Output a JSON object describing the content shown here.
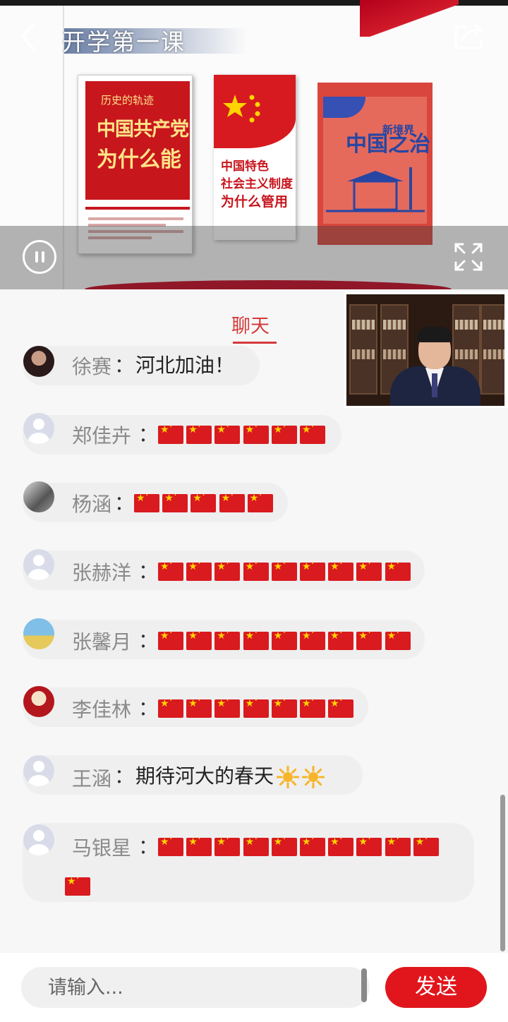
{
  "header": {
    "title": "开学第一课",
    "back_icon": "chevron-left-icon",
    "share_icon": "share-icon"
  },
  "player": {
    "pause_icon": "pause-icon",
    "fullscreen_icon": "fullscreen-icon",
    "books": [
      {
        "line1": "历史的轨迹",
        "line2": "中国共产党",
        "line3": "为什么能"
      },
      {
        "line1": "中国特色",
        "line2": "社会主义制度",
        "line3": "为什么管用"
      },
      {
        "line1": "新境界",
        "line2": "中国之治"
      }
    ]
  },
  "chat": {
    "tab_label": "聊天",
    "colon": "：",
    "messages": [
      {
        "name": "徐赛",
        "text": "河北加油！",
        "flags": 0
      },
      {
        "name": "郑佳卉",
        "text": "",
        "flags": 6
      },
      {
        "name": "杨涵",
        "text": "",
        "flags": 5
      },
      {
        "name": "张赫洋",
        "text": "",
        "flags": 9
      },
      {
        "name": "张馨月",
        "text": "",
        "flags": 9
      },
      {
        "name": "李佳林",
        "text": "",
        "flags": 7
      },
      {
        "name": "王涵",
        "text": "期待河大的春天",
        "suns": 2
      },
      {
        "name": "马银星",
        "text": "",
        "flags": 10,
        "flags_line2": 1
      }
    ]
  },
  "composer": {
    "placeholder": "请输入...",
    "send_label": "发送"
  },
  "colors": {
    "accent": "#d33a3a",
    "send_button": "#e0161c"
  }
}
